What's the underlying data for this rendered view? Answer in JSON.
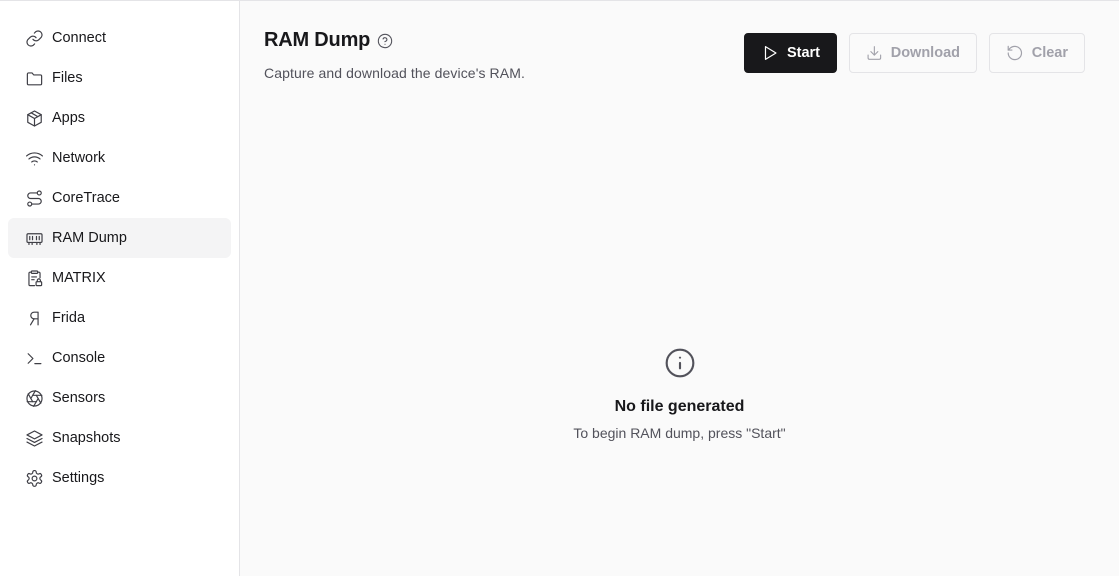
{
  "sidebar": {
    "items": [
      {
        "label": "Connect",
        "icon": "link-icon",
        "active": false
      },
      {
        "label": "Files",
        "icon": "folder-icon",
        "active": false
      },
      {
        "label": "Apps",
        "icon": "package-icon",
        "active": false
      },
      {
        "label": "Network",
        "icon": "wifi-icon",
        "active": false
      },
      {
        "label": "CoreTrace",
        "icon": "route-icon",
        "active": false
      },
      {
        "label": "RAM Dump",
        "icon": "memory-stick-icon",
        "active": true
      },
      {
        "label": "MATRIX",
        "icon": "clipboard-lock-icon",
        "active": false
      },
      {
        "label": "Frida",
        "icon": "frida-icon",
        "active": false
      },
      {
        "label": "Console",
        "icon": "terminal-icon",
        "active": false
      },
      {
        "label": "Sensors",
        "icon": "aperture-icon",
        "active": false
      },
      {
        "label": "Snapshots",
        "icon": "layers-icon",
        "active": false
      },
      {
        "label": "Settings",
        "icon": "gear-icon",
        "active": false
      }
    ]
  },
  "header": {
    "title": "RAM Dump",
    "subtitle": "Capture and download the device's RAM."
  },
  "toolbar": {
    "start_label": "Start",
    "download_label": "Download",
    "clear_label": "Clear"
  },
  "empty_state": {
    "title": "No file generated",
    "message": "To begin RAM dump, press \"Start\""
  },
  "colors": {
    "primary": "#18181b",
    "active_bg": "#f4f4f5",
    "main_bg": "#fafafa",
    "disabled_text": "#a1a1aa"
  }
}
